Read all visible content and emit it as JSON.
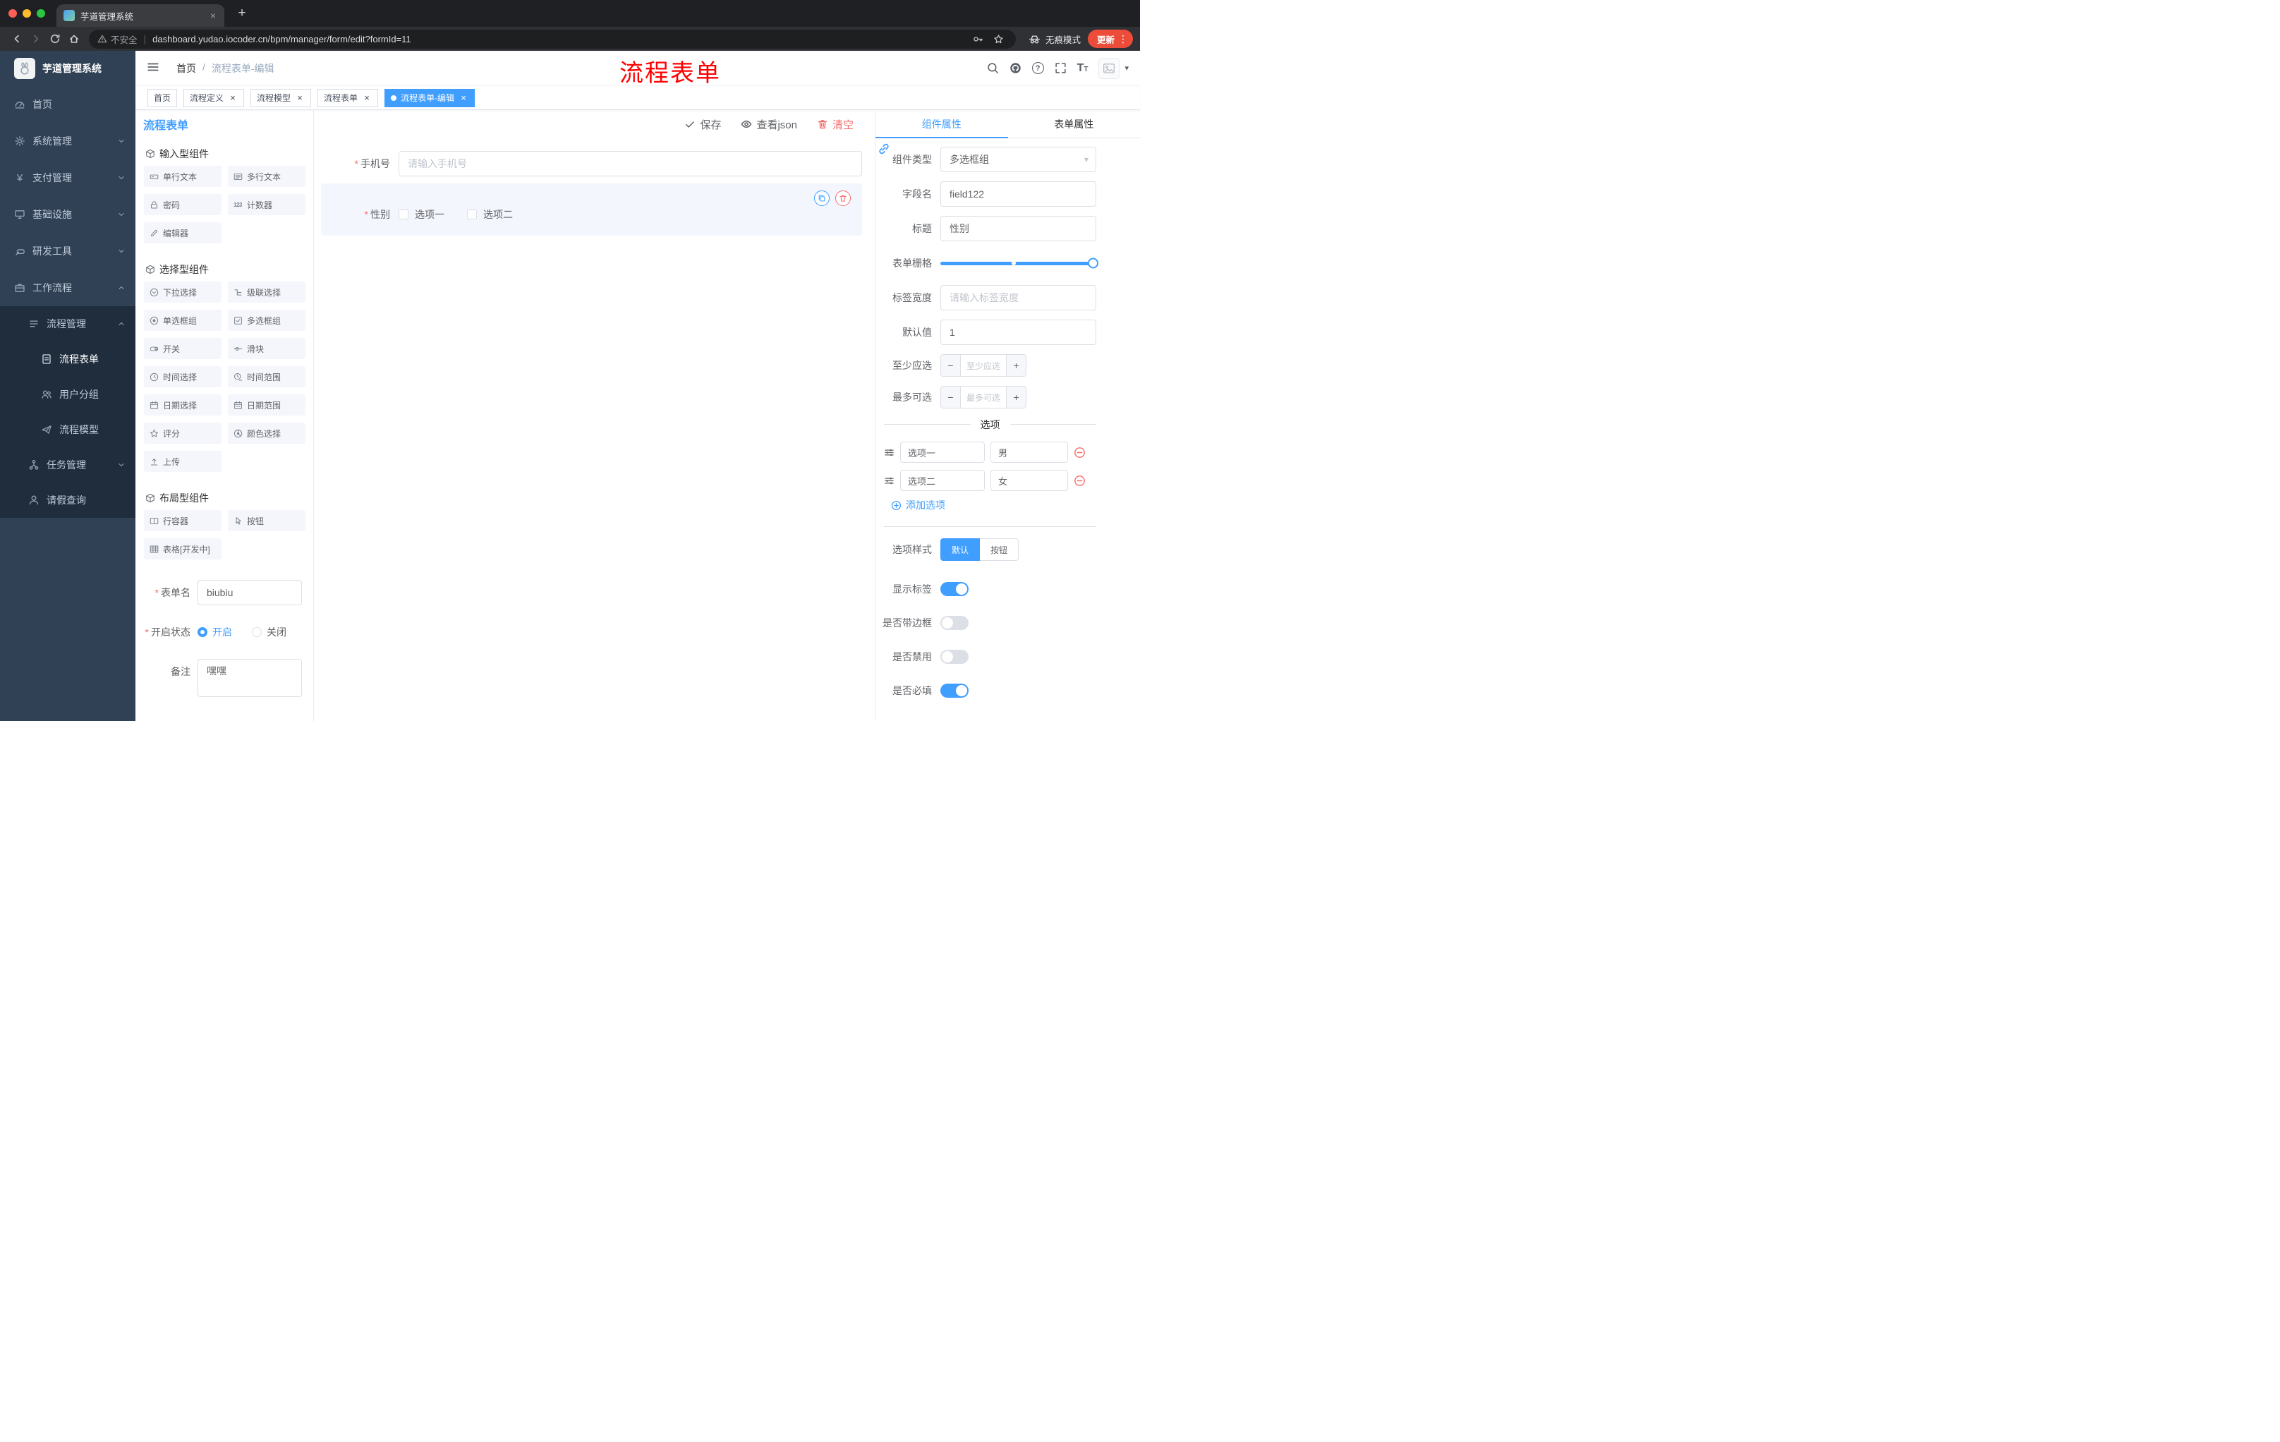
{
  "annotation_overlay": "流程表单",
  "glyphs": {
    "close": "×",
    "plus": "+",
    "kebab": "⋮",
    "caret_down": "▾",
    "minus": "−",
    "asterisk": "*",
    "slash": "/",
    "yen": "¥",
    "question": "?",
    "pipe": "|",
    "counter": "123",
    "font_size": "T"
  },
  "browser": {
    "tab_title": "芋道管理系统",
    "security_label": "不安全",
    "url": "dashboard.yudao.iocoder.cn/bpm/manager/form/edit?formId=11",
    "incognito_label": "无痕模式",
    "update_label": "更新"
  },
  "sidebar": {
    "logo_title": "芋道管理系统",
    "items": [
      {
        "label": "首页"
      },
      {
        "label": "系统管理"
      },
      {
        "label": "支付管理"
      },
      {
        "label": "基础设施"
      },
      {
        "label": "研发工具"
      },
      {
        "label": "工作流程"
      },
      {
        "label": "流程管理"
      },
      {
        "label": "流程表单"
      },
      {
        "label": "用户分组"
      },
      {
        "label": "流程模型"
      },
      {
        "label": "任务管理"
      },
      {
        "label": "请假查询"
      }
    ]
  },
  "header": {
    "breadcrumb_home": "首页",
    "breadcrumb_current": "流程表单-编辑"
  },
  "tags": [
    {
      "label": "首页"
    },
    {
      "label": "流程定义"
    },
    {
      "label": "流程模型"
    },
    {
      "label": "流程表单"
    },
    {
      "label": "流程表单-编辑"
    }
  ],
  "designer": {
    "panel_title": "流程表单",
    "actions": {
      "save": "保存",
      "view_json": "查看json",
      "clear": "清空"
    },
    "palette_sections": [
      {
        "title": "输入型组件",
        "items": [
          "单行文本",
          "多行文本",
          "密码",
          "计数器",
          "编辑器"
        ]
      },
      {
        "title": "选择型组件",
        "items": [
          "下拉选择",
          "级联选择",
          "单选框组",
          "多选框组",
          "开关",
          "滑块",
          "时间选择",
          "时间范围",
          "日期选择",
          "日期范围",
          "评分",
          "颜色选择",
          "上传"
        ]
      },
      {
        "title": "布局型组件",
        "items": [
          "行容器",
          "按钮",
          "表格[开发中]"
        ]
      }
    ],
    "meta": {
      "form_name_label": "表单名",
      "form_name_value": "biubiu",
      "status_label": "开启状态",
      "status_on": "开启",
      "status_off": "关闭",
      "remark_label": "备注",
      "remark_value": "嘿嘿"
    },
    "canvas": {
      "phone_label": "手机号",
      "phone_placeholder": "请输入手机号",
      "gender_label": "性别",
      "gender_options": [
        "选项一",
        "选项二"
      ]
    }
  },
  "inspector": {
    "tabs": [
      "组件属性",
      "表单属性"
    ],
    "component_type_label": "组件类型",
    "component_type_value": "多选框组",
    "field_name_label": "字段名",
    "field_name_value": "field122",
    "title_label": "标题",
    "title_value": "性别",
    "grid_label": "表单栅格",
    "label_width_label": "标签宽度",
    "label_width_placeholder": "请输入标签宽度",
    "default_value_label": "默认值",
    "default_value": "1",
    "min_label": "至少应选",
    "min_placeholder": "至少应选",
    "max_label": "最多可选",
    "max_placeholder": "最多可选",
    "options_title": "选项",
    "options": [
      {
        "label": "选项一",
        "value": "男"
      },
      {
        "label": "选项二",
        "value": "女"
      }
    ],
    "add_option": "添加选项",
    "option_style_label": "选项样式",
    "style_default": "默认",
    "style_button": "按钮",
    "show_label": "显示标签",
    "with_border": "是否带边框",
    "disabled": "是否禁用",
    "required": "是否必填"
  },
  "colors": {
    "accent": "#409eff",
    "danger": "#f56c6c",
    "annotation": "#ff0000"
  }
}
